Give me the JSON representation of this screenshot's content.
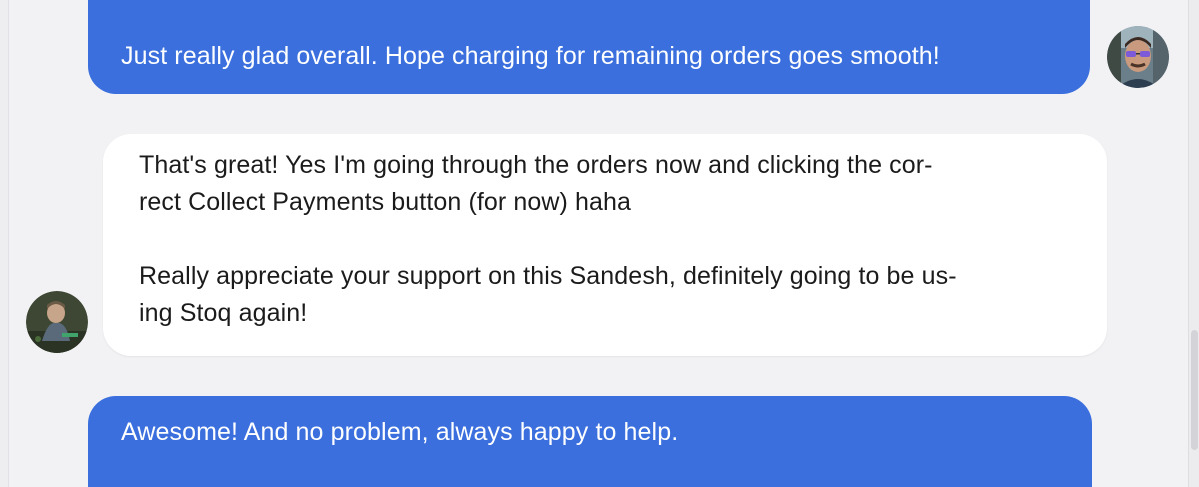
{
  "messages": [
    {
      "direction": "outgoing",
      "lines": [
        "Just really glad overall. Hope charging for remaining orders goes smooth!"
      ]
    },
    {
      "direction": "incoming",
      "paragraphs": [
        {
          "lines": [
            "That's great! Yes I'm going through the orders now and clicking the cor-",
            "rect Collect Payments button (for now) haha"
          ]
        },
        {
          "lines": [
            "Really appreciate your support on this Sandesh, definitely going to be us-",
            "ing Stoq again!"
          ]
        }
      ]
    },
    {
      "direction": "outgoing",
      "lines": [
        "Awesome! And no problem, always happy to help."
      ]
    }
  ],
  "colors": {
    "outgoing_bubble": "#3a6fdd",
    "incoming_bubble": "#ffffff",
    "background": "#f2f2f5"
  }
}
